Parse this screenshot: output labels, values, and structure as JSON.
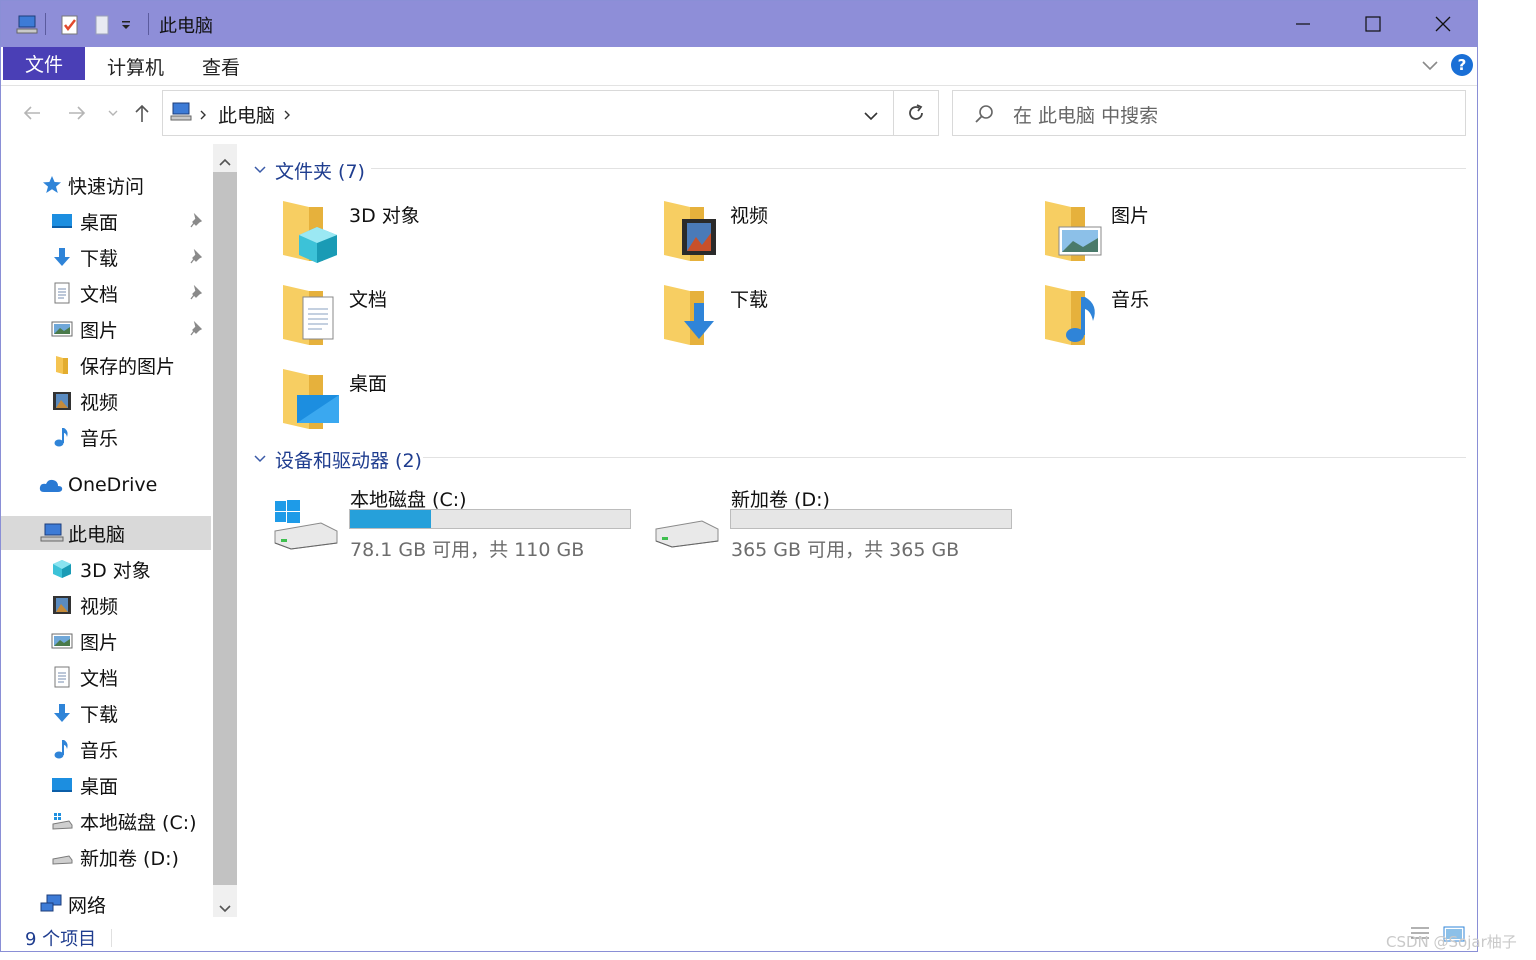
{
  "titlebar": {
    "title": "此电脑"
  },
  "ribbon": {
    "file": "文件",
    "computer": "计算机",
    "view": "查看",
    "help": "?"
  },
  "address": {
    "location": "此电脑"
  },
  "search": {
    "placeholder": "在 此电脑 中搜索"
  },
  "sidebar": {
    "quick_access": "快速访问",
    "qa_items": [
      {
        "label": "桌面",
        "icon": "desktop-icon",
        "pinned": true
      },
      {
        "label": "下载",
        "icon": "download-icon",
        "pinned": true
      },
      {
        "label": "文档",
        "icon": "document-icon",
        "pinned": true
      },
      {
        "label": "图片",
        "icon": "picture-icon",
        "pinned": true
      },
      {
        "label": "保存的图片",
        "icon": "folder-icon",
        "pinned": false
      },
      {
        "label": "视频",
        "icon": "video-icon",
        "pinned": false
      },
      {
        "label": "音乐",
        "icon": "music-icon",
        "pinned": false
      }
    ],
    "onedrive": "OneDrive",
    "this_pc": "此电脑",
    "pc_items": [
      {
        "label": "3D 对象",
        "icon": "cube-icon"
      },
      {
        "label": "视频",
        "icon": "video-icon"
      },
      {
        "label": "图片",
        "icon": "picture-icon"
      },
      {
        "label": "文档",
        "icon": "document-icon"
      },
      {
        "label": "下载",
        "icon": "download-icon"
      },
      {
        "label": "音乐",
        "icon": "music-icon"
      },
      {
        "label": "桌面",
        "icon": "desktop-icon"
      },
      {
        "label": "本地磁盘 (C:)",
        "icon": "drive-c-icon"
      },
      {
        "label": "新加卷 (D:)",
        "icon": "drive-d-icon"
      }
    ],
    "network": "网络"
  },
  "content": {
    "folders_header": "文件夹 (7)",
    "folders": [
      {
        "label": "3D 对象",
        "icon": "cube-folder-icon"
      },
      {
        "label": "视频",
        "icon": "video-folder-icon"
      },
      {
        "label": "图片",
        "icon": "picture-folder-icon"
      },
      {
        "label": "文档",
        "icon": "document-folder-icon"
      },
      {
        "label": "下载",
        "icon": "download-folder-icon"
      },
      {
        "label": "音乐",
        "icon": "music-folder-icon"
      },
      {
        "label": "桌面",
        "icon": "desktop-folder-icon"
      }
    ],
    "drives_header": "设备和驱动器 (2)",
    "drives": [
      {
        "label": "本地磁盘 (C:)",
        "space": "78.1 GB 可用，共 110 GB",
        "used_fraction": 0.29
      },
      {
        "label": "新加卷 (D:)",
        "space": "365 GB 可用，共 365 GB",
        "used_fraction": 0.0
      }
    ]
  },
  "status": {
    "count": "9 个项目"
  },
  "watermark": "CSDN @Sojar柚子",
  "colors": {
    "title_bar": "#8e8ed8",
    "file_tab": "#4a3fb6",
    "accent_text": "#1f3d8f",
    "drive_fill": "#26a0da",
    "folder": "#f5c451"
  }
}
